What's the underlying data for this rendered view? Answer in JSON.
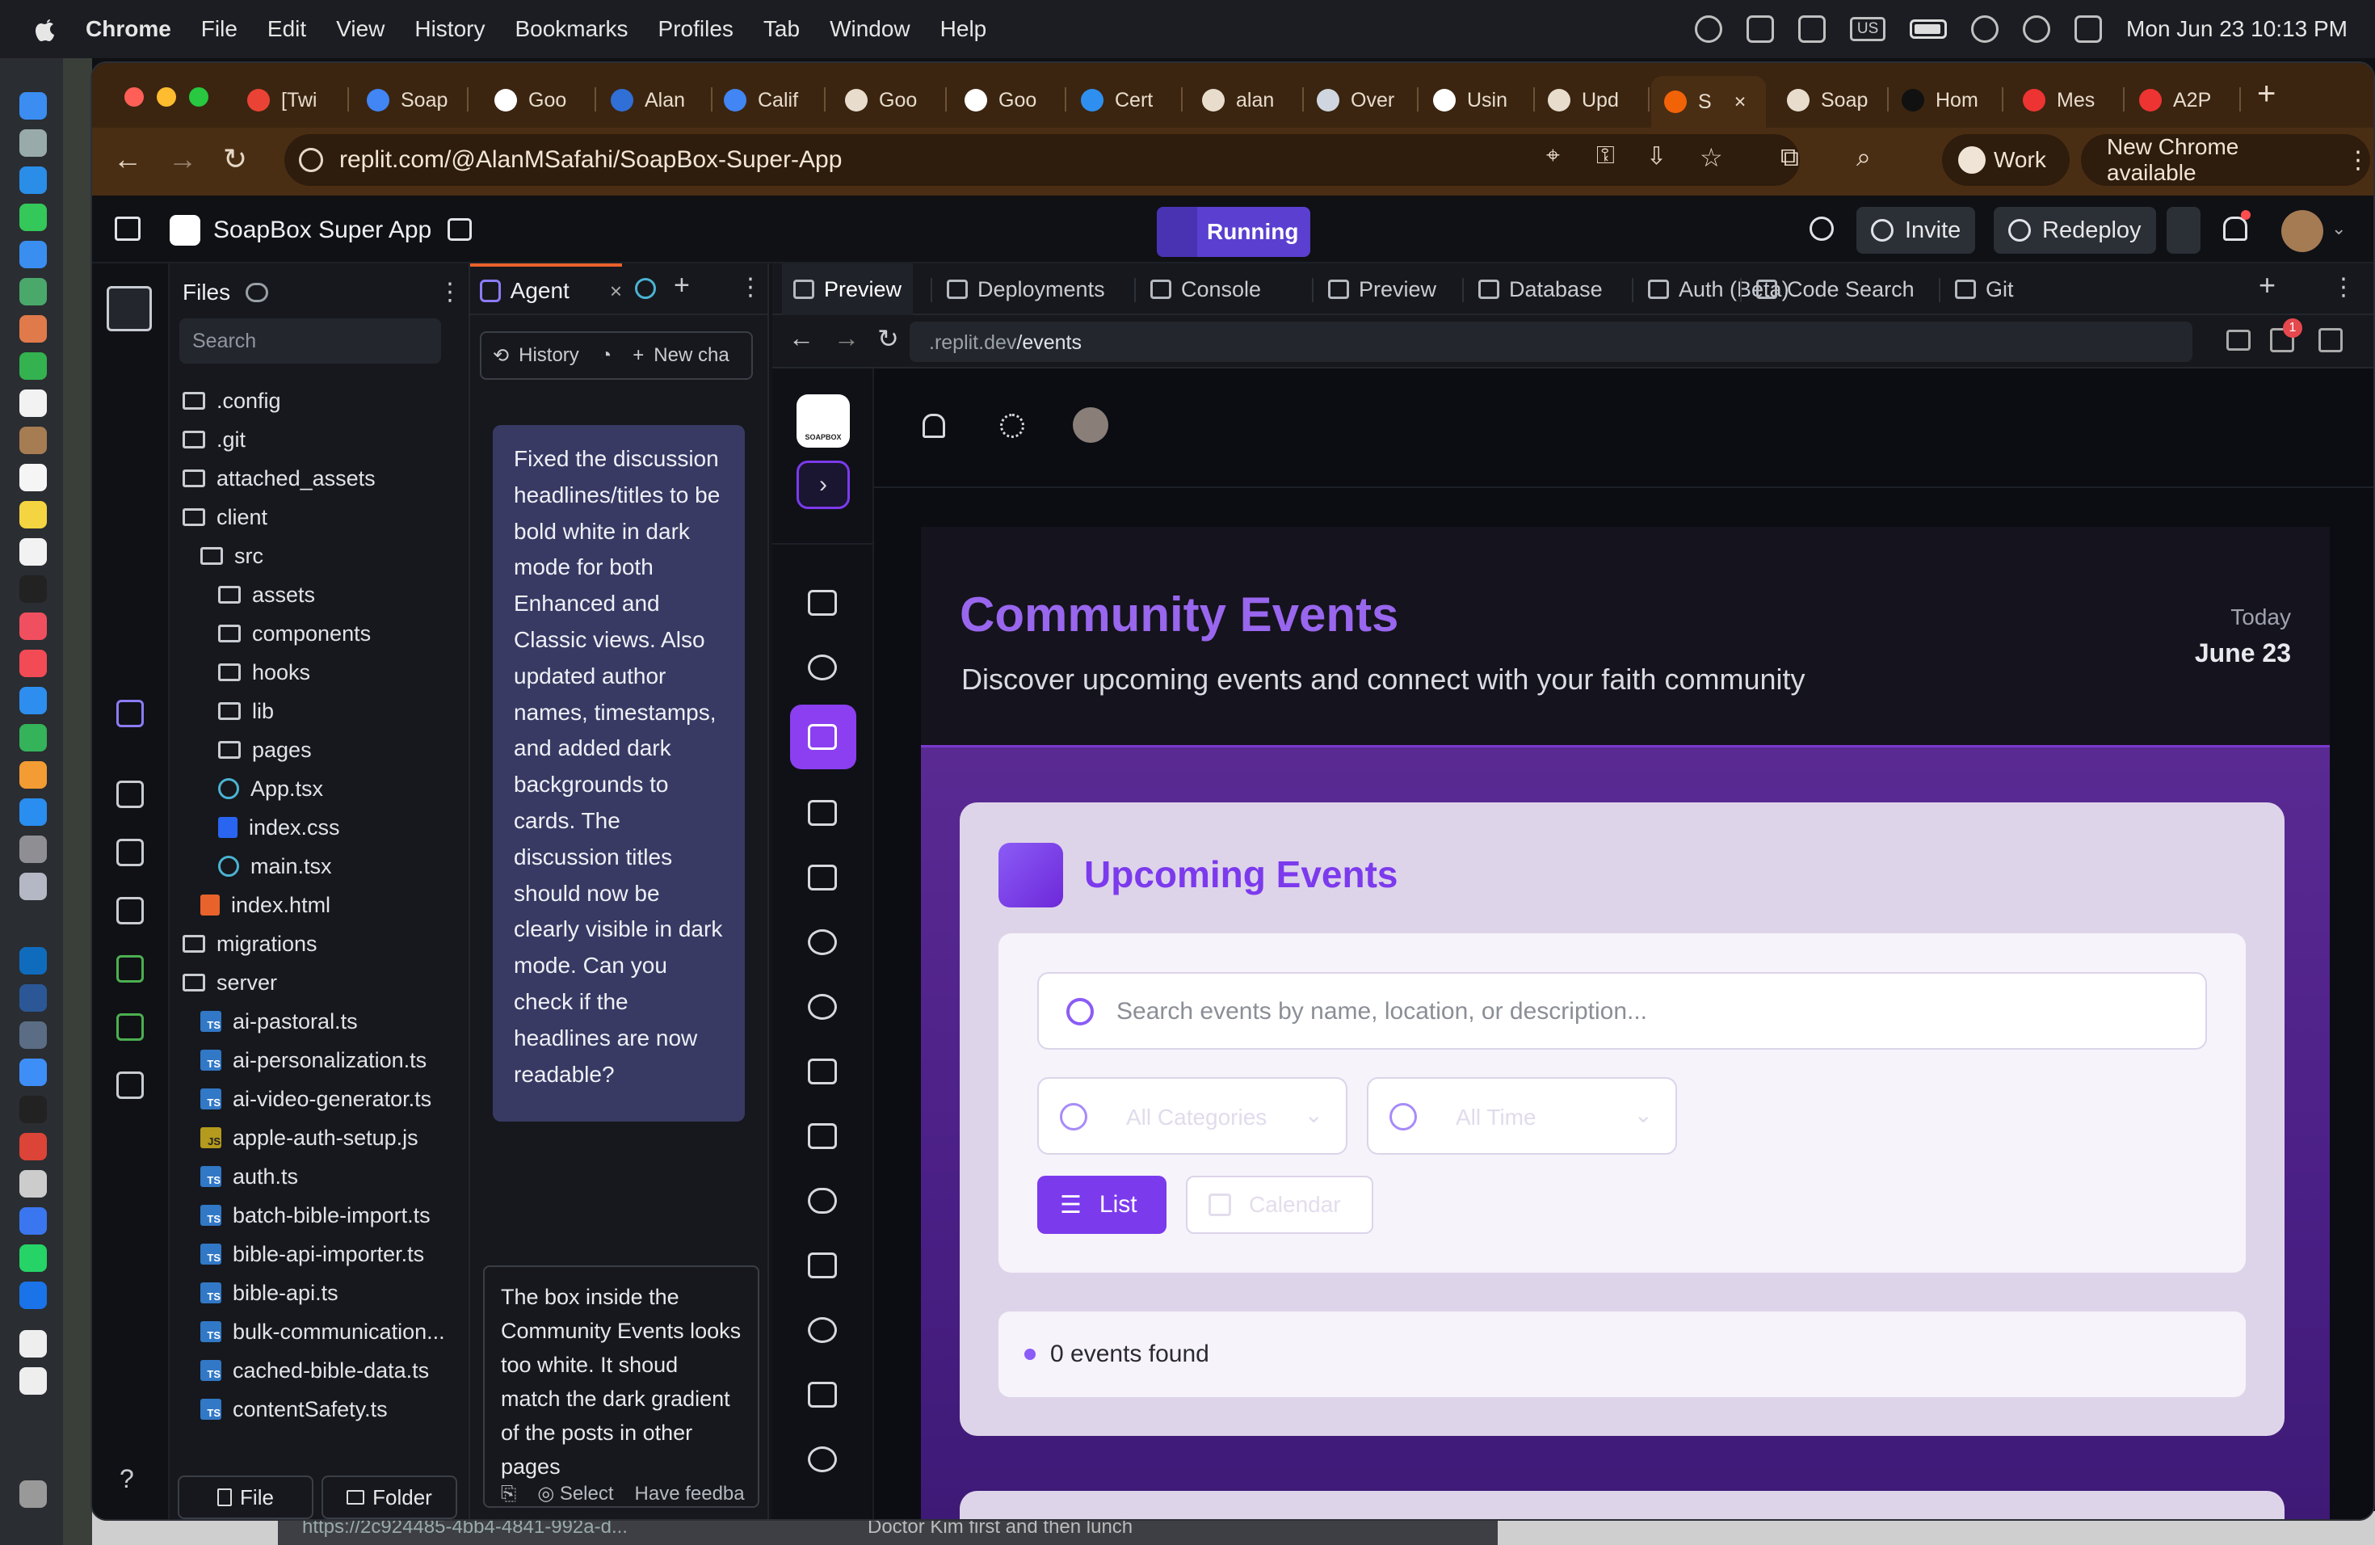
{
  "menubar": {
    "app": "Chrome",
    "items": [
      "File",
      "Edit",
      "View",
      "History",
      "Bookmarks",
      "Profiles",
      "Tab",
      "Window",
      "Help"
    ],
    "input_source": "US",
    "clock": "Mon Jun 23  10:13 PM"
  },
  "browser": {
    "tabs": [
      {
        "label": "[Twi",
        "icon": "gmail-icon"
      },
      {
        "label": "Soap",
        "icon": "docs-icon"
      },
      {
        "label": "Goo",
        "icon": "google-icon"
      },
      {
        "label": "Alan",
        "icon": "blue-icon"
      },
      {
        "label": "Calif",
        "icon": "docs-icon"
      },
      {
        "label": "Goo",
        "icon": "openai-icon"
      },
      {
        "label": "Goo",
        "icon": "google-icon"
      },
      {
        "label": "Cert",
        "icon": "safari-icon"
      },
      {
        "label": "alan",
        "icon": "github-icon"
      },
      {
        "label": "Over",
        "icon": "bag-icon"
      },
      {
        "label": "Usin",
        "icon": "google-icon"
      },
      {
        "label": "Upd",
        "icon": "github-icon"
      },
      {
        "label": "S",
        "icon": "replit-icon",
        "active": true
      },
      {
        "label": "Soap",
        "icon": "soapbox-icon"
      },
      {
        "label": "Hom",
        "icon": "x-icon"
      },
      {
        "label": "Mes",
        "icon": "red-icon"
      },
      {
        "label": "A2P",
        "icon": "red-icon"
      }
    ],
    "url": "replit.com/@AlanMSafahi/SoapBox-Super-App",
    "profile": "Work",
    "update_label": "New Chrome available"
  },
  "replit": {
    "project": "SoapBox Super App",
    "status": "Running",
    "invite": "Invite",
    "redeploy": "Redeploy",
    "files_title": "Files",
    "search_placeholder": "Search",
    "tree": [
      {
        "name": ".config",
        "type": "folder",
        "depth": 0
      },
      {
        "name": ".git",
        "type": "folder",
        "depth": 0
      },
      {
        "name": "attached_assets",
        "type": "folder",
        "depth": 0
      },
      {
        "name": "client",
        "type": "folder-open",
        "depth": 0
      },
      {
        "name": "src",
        "type": "folder-open",
        "depth": 1
      },
      {
        "name": "assets",
        "type": "folder",
        "depth": 2
      },
      {
        "name": "components",
        "type": "folder",
        "depth": 2
      },
      {
        "name": "hooks",
        "type": "folder",
        "depth": 2
      },
      {
        "name": "lib",
        "type": "folder",
        "depth": 2
      },
      {
        "name": "pages",
        "type": "folder",
        "depth": 2
      },
      {
        "name": "App.tsx",
        "type": "react",
        "depth": 2
      },
      {
        "name": "index.css",
        "type": "css",
        "depth": 2
      },
      {
        "name": "main.tsx",
        "type": "react",
        "depth": 2
      },
      {
        "name": "index.html",
        "type": "html",
        "depth": 1
      },
      {
        "name": "migrations",
        "type": "folder",
        "depth": 0
      },
      {
        "name": "server",
        "type": "folder-open",
        "depth": 0
      },
      {
        "name": "ai-pastoral.ts",
        "type": "ts",
        "depth": 1
      },
      {
        "name": "ai-personalization.ts",
        "type": "ts",
        "depth": 1
      },
      {
        "name": "ai-video-generator.ts",
        "type": "ts",
        "depth": 1
      },
      {
        "name": "apple-auth-setup.js",
        "type": "js",
        "depth": 1
      },
      {
        "name": "auth.ts",
        "type": "ts",
        "depth": 1
      },
      {
        "name": "batch-bible-import.ts",
        "type": "ts",
        "depth": 1
      },
      {
        "name": "bible-api-importer.ts",
        "type": "ts",
        "depth": 1
      },
      {
        "name": "bible-api.ts",
        "type": "ts",
        "depth": 1
      },
      {
        "name": "bulk-communication...",
        "type": "ts",
        "depth": 1
      },
      {
        "name": "cached-bible-data.ts",
        "type": "ts",
        "depth": 1
      },
      {
        "name": "contentSafety.ts",
        "type": "ts",
        "depth": 1
      }
    ],
    "file_btn": "File",
    "folder_btn": "Folder",
    "agent_tab": "Agent",
    "history_btn": "History",
    "new_chat_btn": "New cha",
    "agent_message": "Fixed the discussion headlines/titles to be bold white in dark mode for both Enhanced and Classic views. Also updated author names, timestamps, and added dark backgrounds to cards. The discussion titles should now be clearly visible in dark mode. Can you check if the headlines are now readable?",
    "composer_text": "The box inside the Community Events looks too white. It shoud match the dark gradient of the posts in other pages",
    "select_label": "Select",
    "feedback_label": "Have feedba",
    "work_tabs": [
      "Preview",
      "Deployments",
      "Console",
      "Preview",
      "Database",
      "Auth (Beta)",
      "Code Search",
      "Git"
    ],
    "preview_url_domain": ".replit.dev",
    "preview_url_path": "/events",
    "notif_count": "1"
  },
  "app": {
    "logo_caption": "SOAPBOX",
    "title": "Community Events",
    "subtitle": "Discover upcoming events and connect with your faith community",
    "today_label": "Today",
    "today_date": "June 23",
    "card_title": "Upcoming Events",
    "search_placeholder": "Search events by name, location, or description...",
    "category_select": "All Categories",
    "time_select": "All Time",
    "list_btn": "List",
    "calendar_btn": "Calendar",
    "count_text": "0 events found"
  },
  "taskbar_below": {
    "left": "https://2c924485-4bb4-4841-992a-d...",
    "right": "Doctor Kim first and then lunch"
  },
  "colors": {
    "accent": "#7c3aed",
    "hero_title": "#9966ee",
    "running": "#5b3fd0",
    "chrome_tab": "#3b2510"
  }
}
